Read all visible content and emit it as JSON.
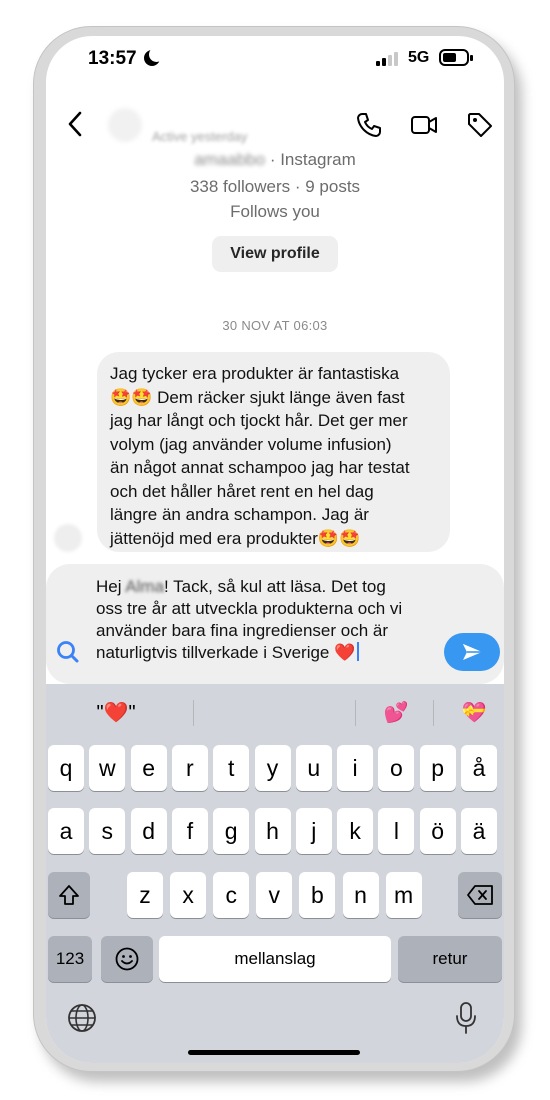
{
  "status_bar": {
    "time": "13:57",
    "network": "5G"
  },
  "header": {
    "active_status": "Active yesterday"
  },
  "profile": {
    "username": "amaabbo",
    "platform": "· Instagram",
    "followers_posts": "338 followers · 9 posts",
    "follows_you": "Follows you",
    "view_profile_label": "View profile"
  },
  "timestamp": "30 NOV AT 06:03",
  "message": {
    "line1": "Jag tycker era produkter är fantastiska",
    "line2_emoji": "🤩🤩",
    "line2_text": " Dem räcker sjukt länge även fast",
    "line3": "jag har långt och tjockt hår. Det ger mer",
    "line4": "volym (jag använder volume infusion)",
    "line5": "än något annat schampoo jag har testat",
    "line6": "och det håller håret rent en hel dag",
    "line7": "längre än andra schampon. Jag är",
    "line8_text": "jättenöjd med era produkter",
    "line8_emoji": "🤩🤩"
  },
  "composer": {
    "greeting": "Hej ",
    "name": "Alma",
    "line1_rest": "! Tack, så kul att läsa. Det tog",
    "line2": "oss tre år att utveckla produkterna och vi",
    "line3": "använder bara fina ingredienser och är",
    "line4_text": "naturligtvis tillverkade i Sverige ",
    "line4_emoji": "❤️"
  },
  "keyboard": {
    "suggestions": [
      "\"❤️\"",
      "💕",
      "💝"
    ],
    "row1": [
      "q",
      "w",
      "e",
      "r",
      "t",
      "y",
      "u",
      "i",
      "o",
      "p",
      "å"
    ],
    "row2": [
      "a",
      "s",
      "d",
      "f",
      "g",
      "h",
      "j",
      "k",
      "l",
      "ö",
      "ä"
    ],
    "row3": [
      "z",
      "x",
      "c",
      "v",
      "b",
      "n",
      "m"
    ],
    "numbers_label": "123",
    "space_label": "mellanslag",
    "return_label": "retur",
    "icons": [
      "shift-icon",
      "backspace-icon",
      "emoji-icon",
      "globe-icon",
      "microphone-icon"
    ]
  },
  "colors": {
    "accent": "#3897f0",
    "bubble": "#efefef",
    "keyboard_bg": "#d3d5dc",
    "heart": "#e0245e"
  }
}
